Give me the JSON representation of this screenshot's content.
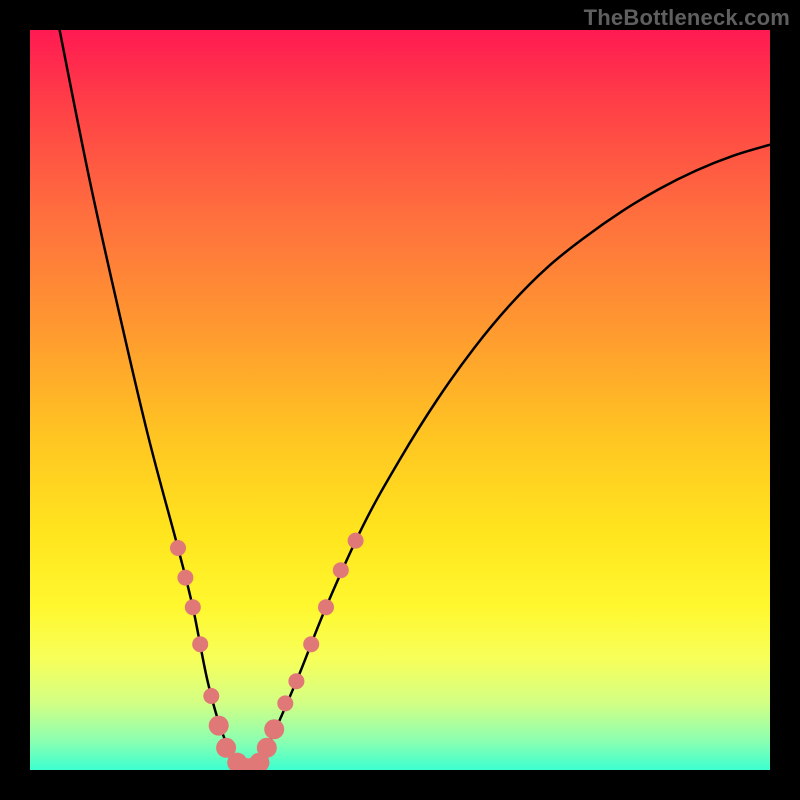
{
  "watermark": "TheBottleneck.com",
  "chart_data": {
    "type": "line",
    "title": "",
    "xlabel": "",
    "ylabel": "",
    "xlim": [
      0,
      100
    ],
    "ylim": [
      0,
      100
    ],
    "series": [
      {
        "name": "curve",
        "x": [
          4,
          8,
          12,
          16,
          20,
          22,
          24,
          26,
          28,
          30,
          32,
          36,
          40,
          45,
          50,
          55,
          60,
          65,
          70,
          75,
          80,
          85,
          90,
          95,
          100
        ],
        "y": [
          100,
          80,
          62,
          45,
          30,
          22,
          12,
          5,
          1,
          0,
          3,
          12,
          22,
          33,
          42,
          50,
          57,
          63,
          68,
          72,
          75.5,
          78.5,
          81,
          83,
          84.5
        ]
      }
    ],
    "markers": {
      "name": "region-markers",
      "color": "#e07878",
      "points": [
        {
          "x": 20.0,
          "y": 30.0,
          "r": 8
        },
        {
          "x": 21.0,
          "y": 26.0,
          "r": 8
        },
        {
          "x": 22.0,
          "y": 22.0,
          "r": 8
        },
        {
          "x": 23.0,
          "y": 17.0,
          "r": 8
        },
        {
          "x": 24.5,
          "y": 10.0,
          "r": 8
        },
        {
          "x": 25.5,
          "y": 6.0,
          "r": 10
        },
        {
          "x": 26.5,
          "y": 3.0,
          "r": 10
        },
        {
          "x": 28.0,
          "y": 1.0,
          "r": 10
        },
        {
          "x": 29.0,
          "y": 0.3,
          "r": 10
        },
        {
          "x": 30.0,
          "y": 0.3,
          "r": 10
        },
        {
          "x": 31.0,
          "y": 1.0,
          "r": 10
        },
        {
          "x": 32.0,
          "y": 3.0,
          "r": 10
        },
        {
          "x": 33.0,
          "y": 5.5,
          "r": 10
        },
        {
          "x": 34.5,
          "y": 9.0,
          "r": 8
        },
        {
          "x": 36.0,
          "y": 12.0,
          "r": 8
        },
        {
          "x": 38.0,
          "y": 17.0,
          "r": 8
        },
        {
          "x": 40.0,
          "y": 22.0,
          "r": 8
        },
        {
          "x": 42.0,
          "y": 27.0,
          "r": 8
        },
        {
          "x": 44.0,
          "y": 31.0,
          "r": 8
        }
      ]
    },
    "background_gradient": {
      "direction": "top-to-bottom",
      "stops": [
        {
          "pos": 0,
          "color": "#ff1a52"
        },
        {
          "pos": 25,
          "color": "#ff6f3e"
        },
        {
          "pos": 55,
          "color": "#ffc522"
        },
        {
          "pos": 78,
          "color": "#fff82f"
        },
        {
          "pos": 100,
          "color": "#3cffd0"
        }
      ]
    }
  }
}
